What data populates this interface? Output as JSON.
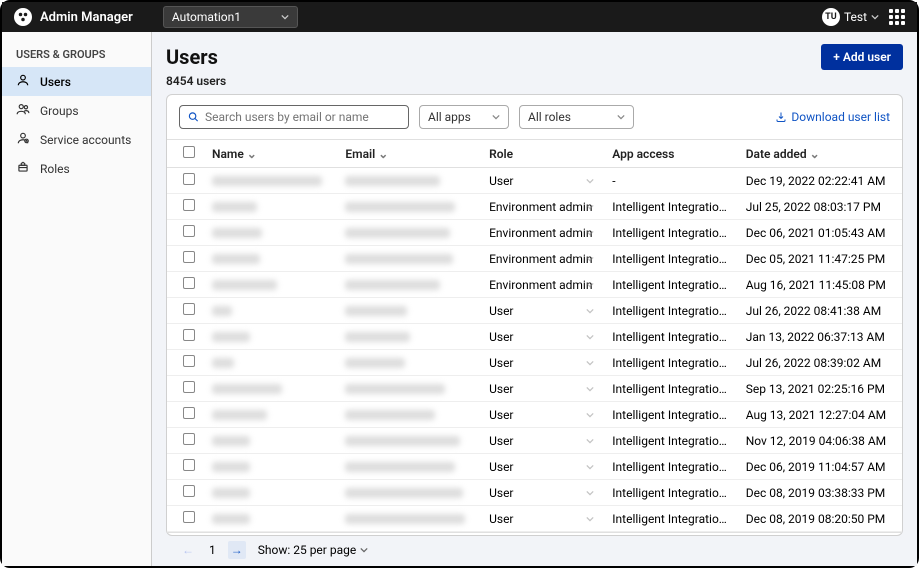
{
  "header": {
    "app_name": "Admin Manager",
    "org": "Automation1",
    "user_initials": "TU",
    "user_name": "Test"
  },
  "sidebar": {
    "section": "USERS & GROUPS",
    "items": [
      {
        "label": "Users",
        "active": true
      },
      {
        "label": "Groups",
        "active": false
      },
      {
        "label": "Service accounts",
        "active": false
      },
      {
        "label": "Roles",
        "active": false
      }
    ]
  },
  "page": {
    "title": "Users",
    "add_button": "+ Add user",
    "count_text": "8454 users"
  },
  "toolbar": {
    "search_placeholder": "Search users by email or name",
    "filter_apps": "All apps",
    "filter_roles": "All roles",
    "download": "Download user list"
  },
  "columns": [
    "Name",
    "Email",
    "Role",
    "App access",
    "Date added"
  ],
  "rows": [
    {
      "role": "User",
      "access": "-",
      "date": "Dec 19, 2022 02:22:41 AM",
      "nw": 110,
      "ew": 95
    },
    {
      "role": "Environment admin",
      "access": "Intelligent Integration Platfo...",
      "date": "Jul 25, 2022 08:03:17 PM",
      "nw": 45,
      "ew": 110
    },
    {
      "role": "Environment admin",
      "access": "Intelligent Integration Platfo...",
      "date": "Dec 06, 2021 01:05:43 AM",
      "nw": 50,
      "ew": 105
    },
    {
      "role": "Environment admin",
      "access": "Intelligent Integration Platfo...",
      "date": "Dec 05, 2021 11:47:25 PM",
      "nw": 48,
      "ew": 108
    },
    {
      "role": "Environment admin",
      "access": "Intelligent Integration Platfo...",
      "date": "Aug 16, 2021 11:45:08 PM",
      "nw": 65,
      "ew": 95
    },
    {
      "role": "User",
      "access": "Intelligent Integration Platfo...",
      "date": "Jul 26, 2022 08:41:38 AM",
      "nw": 20,
      "ew": 62
    },
    {
      "role": "User",
      "access": "Intelligent Integration Platfo...",
      "date": "Jan 13, 2022 06:37:13 AM",
      "nw": 38,
      "ew": 65
    },
    {
      "role": "User",
      "access": "Intelligent Integration Platfo...",
      "date": "Jul 26, 2022 08:39:02 AM",
      "nw": 22,
      "ew": 60
    },
    {
      "role": "User",
      "access": "Intelligent Integration Platfo...",
      "date": "Sep 13, 2021 02:25:16 PM",
      "nw": 70,
      "ew": 100
    },
    {
      "role": "User",
      "access": "Intelligent Integration Platfo...",
      "date": "Aug 13, 2021 12:27:04 AM",
      "nw": 55,
      "ew": 90
    },
    {
      "role": "User",
      "access": "Intelligent Integration Platfo...",
      "date": "Nov 12, 2019 04:06:38 AM",
      "nw": 38,
      "ew": 115
    },
    {
      "role": "User",
      "access": "Intelligent Integration Platfo...",
      "date": "Dec 06, 2019 11:04:57 AM",
      "nw": 38,
      "ew": 110
    },
    {
      "role": "User",
      "access": "Intelligent Integration Platfo...",
      "date": "Dec 08, 2019 03:38:33 PM",
      "nw": 38,
      "ew": 118
    },
    {
      "role": "User",
      "access": "Intelligent Integration Platfo...",
      "date": "Dec 08, 2019 08:20:50 PM",
      "nw": 38,
      "ew": 120
    }
  ],
  "pagination": {
    "page": "1",
    "per_page_label": "Show: 25 per page"
  }
}
